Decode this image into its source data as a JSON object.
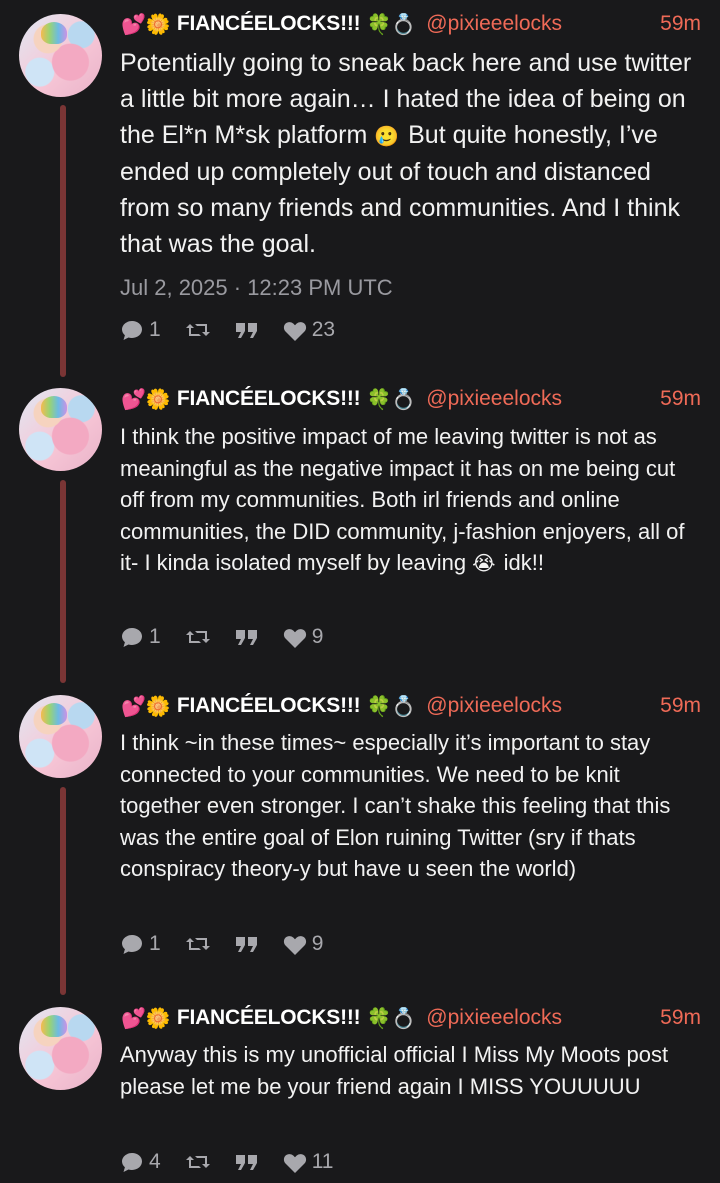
{
  "posts": [
    {
      "display_name": "FIANCÉELOCKS!!!",
      "prefix_emoji": "💕🌼",
      "suffix_emoji": "🍀💍",
      "handle": "@pixieeelocks",
      "time": "59m",
      "text_a": "Potentially going to sneak back here and use twitter a little bit more again… I hated the idea of being on the El*n M*sk platform ",
      "emoji": "🥲",
      "text_b": " But quite honestly, I’ve ended up completely out of touch and distanced from so many friends and communities. And I think that was the goal.",
      "date": "Jul 2, 2025 · 12:23 PM UTC",
      "replies": "1",
      "likes": "23"
    },
    {
      "display_name": "FIANCÉELOCKS!!!",
      "prefix_emoji": "💕🌼",
      "suffix_emoji": "🍀💍",
      "handle": "@pixieeelocks",
      "time": "59m",
      "text_a": "I think the positive impact of me leaving twitter is not as meaningful as the negative impact it has on me being cut off from my communities. Both irl friends and online communities, the DID community, j-fashion enjoyers, all of it- I kinda isolated myself by leaving ",
      "emoji": "😭",
      "text_b": " idk!!",
      "replies": "1",
      "likes": "9"
    },
    {
      "display_name": "FIANCÉELOCKS!!!",
      "prefix_emoji": "💕🌼",
      "suffix_emoji": "🍀💍",
      "handle": "@pixieeelocks",
      "time": "59m",
      "text_a": "I think ~in these times~ especially it’s important to stay connected to your communities. We need to be knit together even stronger. I can’t shake this feeling that this was the entire goal of Elon ruining Twitter (sry if thats conspiracy theory-y but have u seen the world)",
      "replies": "1",
      "likes": "9"
    },
    {
      "display_name": "FIANCÉELOCKS!!!",
      "prefix_emoji": "💕🌼",
      "suffix_emoji": "🍀💍",
      "handle": "@pixieeelocks",
      "time": "59m",
      "text_a": "Anyway this is my unofficial official I Miss My Moots post please let me be your friend again I MISS YOUUUUU",
      "replies": "4",
      "likes": "11"
    }
  ],
  "icons": {
    "reply": "comment-icon",
    "retweet": "retweet-icon",
    "quote": "quote-icon",
    "like": "heart-icon"
  },
  "colors": {
    "background": "#19191b",
    "accent": "#ef6a57",
    "thread_line": "#7a3535"
  }
}
